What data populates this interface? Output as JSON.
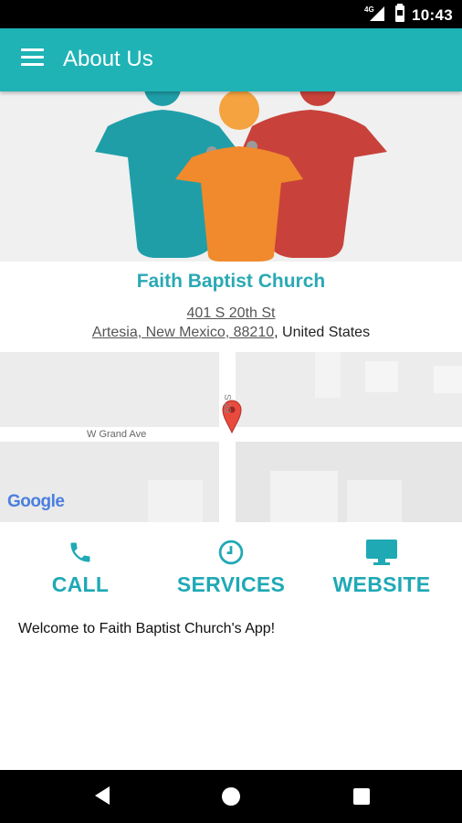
{
  "status_bar": {
    "time": "10:43",
    "network": "4G"
  },
  "app_bar": {
    "title": "About Us"
  },
  "church": {
    "name": "Faith Baptist Church",
    "address_line1": "401 S 20th St",
    "address_city": "Artesia, New Mexico, 88210",
    "address_country": ", United States"
  },
  "map": {
    "street_label": "W Grand Ave",
    "cross_street_label": "S 20",
    "google_logo": "Google"
  },
  "actions": [
    {
      "label": "CALL",
      "icon": "phone-icon"
    },
    {
      "label": "SERVICES",
      "icon": "clock-icon"
    },
    {
      "label": "WEBSITE",
      "icon": "monitor-icon"
    }
  ],
  "welcome_text": "Welcome to Faith Baptist Church's App!",
  "colors": {
    "accent": "#1fb3b6",
    "teal_figure": "#1f9ea8",
    "orange_figure": "#f08a2c",
    "red_figure": "#c8423b"
  }
}
